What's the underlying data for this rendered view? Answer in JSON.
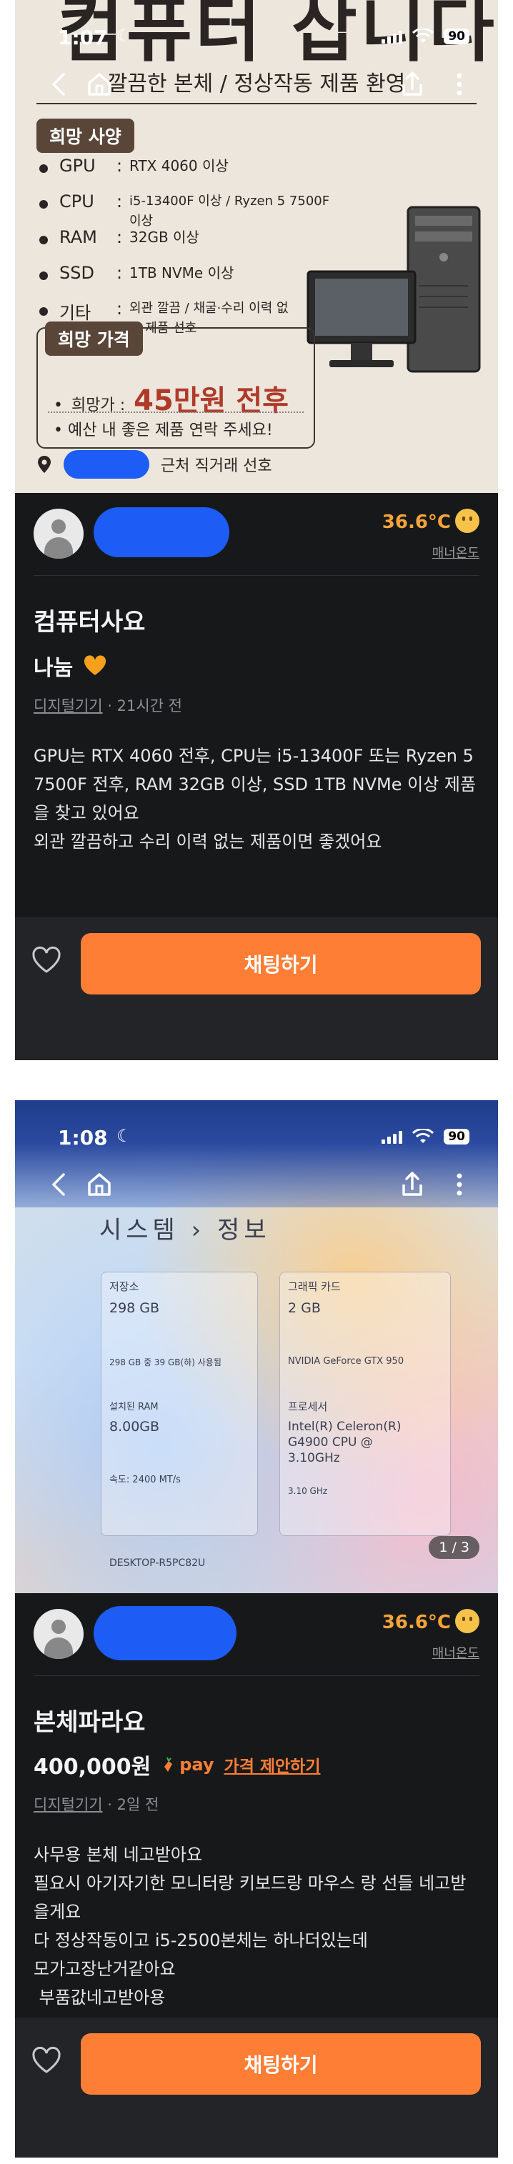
{
  "screenshot1": {
    "status": {
      "time": "1:07",
      "battery": "90"
    },
    "poster": {
      "headline": "컴퓨터 삽니다",
      "subtitle": "깔끔한 본체 / 정상작동 제품 환영",
      "spec_tag": "희망 사양",
      "specs": [
        {
          "key": "GPU",
          "value": "RTX 4060 이상"
        },
        {
          "key": "CPU",
          "value": "i5-13400F 이상 / Ryzen 5 7500F 이상"
        },
        {
          "key": "RAM",
          "value": "32GB 이상"
        },
        {
          "key": "SSD",
          "value": "1TB NVMe 이상"
        },
        {
          "key": "기타",
          "value": "외관 깔끔 / 채굴·수리 이력 없는 제품 선호"
        }
      ],
      "price_tag": "희망 가격",
      "price_label": "희망가 :",
      "price_value": "45만원 전후",
      "price_note": "예산 내 좋은 제품 연락 주세요!",
      "location": "근처 직거래 선호"
    },
    "seller": {
      "temperature": "36.6°C",
      "manner_label": "매너온도"
    },
    "post": {
      "title": "컴퓨터사요",
      "price": "나눔",
      "category": "디지털기기",
      "time": "· 21시간 전",
      "body": "GPU는 RTX 4060 전후, CPU는 i5-13400F 또는 Ryzen 5 7500F 전후, RAM 32GB 이상, SSD 1TB NVMe 이상 제품을 찾고 있어요\n외관 깔끔하고 수리 이력 없는 제품이면 좋겠어요"
    },
    "chat_button": "채팅하기"
  },
  "screenshot2": {
    "status": {
      "time": "1:08",
      "battery": "90"
    },
    "photo": {
      "heading": "시스템 › 정보",
      "storage_label": "저장소",
      "storage_value": "298 GB",
      "storage_used": "298 GB 중 39 GB(하) 사용됨",
      "ram_label": "설치된 RAM",
      "ram_value": "8.00GB",
      "speed": "속도: 2400 MT/s",
      "graphics_label": "그래픽 카드",
      "graphics_value": "2 GB",
      "graphics_model": "NVIDIA GeForce GTX 950",
      "cpu_label": "프로세서",
      "cpu_value": "Intel(R) Celeron(R) G4900 CPU @ 3.10GHz",
      "cpu_speed": "3.10 GHz",
      "device": "DESKTOP-R5PC82U",
      "counter": "1 / 3"
    },
    "seller": {
      "temperature": "36.6°C",
      "manner_label": "매너온도"
    },
    "post": {
      "title": "본체파라요",
      "price": "400,000원",
      "pay_label": "pay",
      "offer_label": "가격 제안하기",
      "category": "디지털기기",
      "time": "· 2일 전",
      "body": "사무용 본체 네고받아요\n필요시 아기자기한 모니터랑 키보드랑 마우스 랑 선들 네고받을게요\n다 정상작동이고 i5-2500본체는 하나더있는데\n모가고장난거같아요\n 부품값네고받아용"
    },
    "chat_button": "채팅하기"
  }
}
